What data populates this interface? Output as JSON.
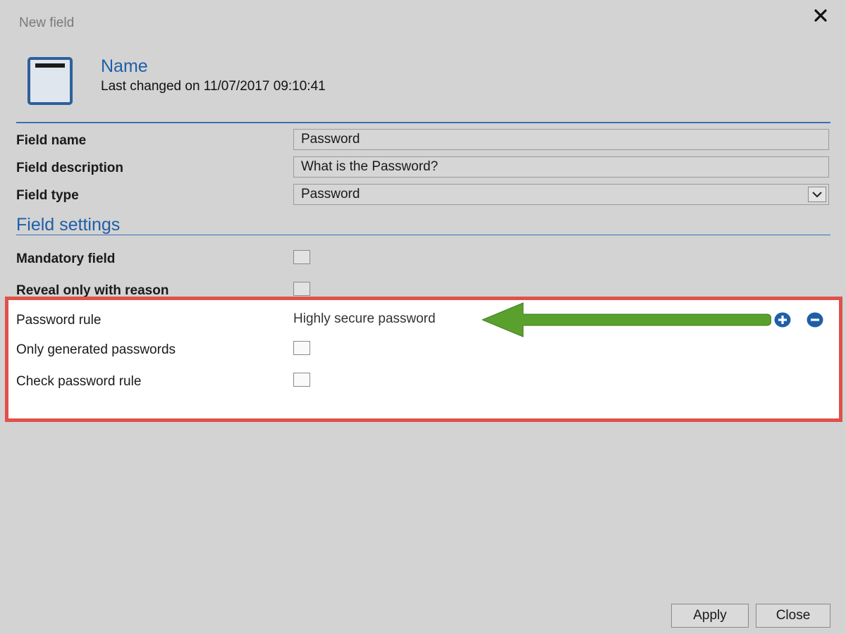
{
  "dialog": {
    "title": "New field"
  },
  "header": {
    "name": "Name",
    "last_changed": "Last changed on 11/07/2017 09:10:41"
  },
  "form": {
    "field_name_label": "Field name",
    "field_name_value": "Password",
    "field_description_label": "Field description",
    "field_description_value": "What is the Password?",
    "field_type_label": "Field type",
    "field_type_value": "Password"
  },
  "settings": {
    "title": "Field settings",
    "mandatory_label": "Mandatory field",
    "reveal_label": "Reveal only with reason",
    "password_rule_label": "Password rule",
    "password_rule_value": "Highly secure password",
    "only_generated_label": "Only generated passwords",
    "check_rule_label": "Check password rule"
  },
  "footer": {
    "apply_label": "Apply",
    "close_label": "Close"
  },
  "colors": {
    "accent": "#1f5fa8",
    "highlight_border": "#e0514a",
    "arrow": "#5aa02c"
  }
}
